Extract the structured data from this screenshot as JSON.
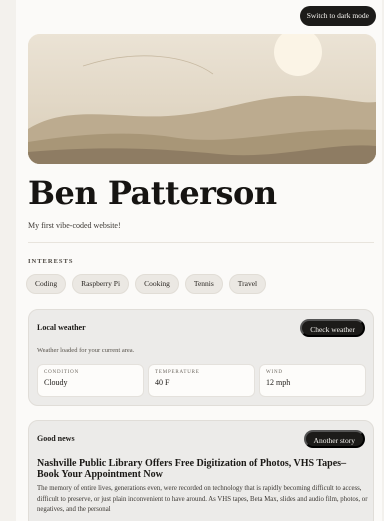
{
  "header": {
    "dark_mode_label": "Switch to dark mode"
  },
  "profile": {
    "name": "Ben Patterson",
    "tagline": "My first vibe-coded website!"
  },
  "interests": {
    "label": "INTERESTS",
    "items": [
      "Coding",
      "Raspberry Pi",
      "Cooking",
      "Tennis",
      "Travel"
    ]
  },
  "weather": {
    "title": "Local weather",
    "button_label": "Check weather",
    "status": "Weather loaded for your current area.",
    "stats": [
      {
        "label": "CONDITION",
        "value": "Cloudy"
      },
      {
        "label": "TEMPERATURE",
        "value": "40 F"
      },
      {
        "label": "WIND",
        "value": "12 mph"
      }
    ]
  },
  "news": {
    "title": "Good news",
    "button_label": "Another story",
    "headline": "Nashville Public Library Offers Free Digitization of Photos, VHS Tapes–Book Your Appointment Now",
    "body": "The memory of entire lives, generations even, were recorded on technology that is rapidly becoming difficult to access, difficult to preserve, or just plain inconvenient to have around. As VHS tapes, Beta Max, slides and audio film, photos, or negatives, and the personal"
  },
  "colors": {
    "background": "#f3f1ed",
    "button_dark": "#1c1b19",
    "sun": "#fbf4e6",
    "hill_light": "#b9a88d",
    "hill_dark": "#8e7c63"
  }
}
